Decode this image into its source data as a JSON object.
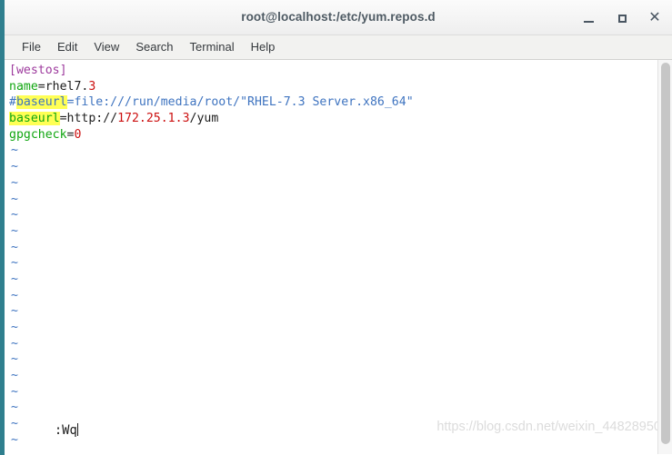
{
  "window": {
    "title": "root@localhost:/etc/yum.repos.d",
    "accent_border": "#2f7f8e",
    "controls": {
      "minimize": "_",
      "maximize": "□",
      "close": "✕"
    }
  },
  "menubar": {
    "items": [
      {
        "label": "File"
      },
      {
        "label": "Edit"
      },
      {
        "label": "View"
      },
      {
        "label": "Search"
      },
      {
        "label": "Terminal"
      },
      {
        "label": "Help"
      }
    ]
  },
  "editor": {
    "filler_char": "~",
    "filler_count": 19,
    "command_line": ":Wq",
    "lines": [
      {
        "segments": [
          {
            "text": "[westos]",
            "style": "c-section",
            "highlight": false
          }
        ]
      },
      {
        "segments": [
          {
            "text": "name",
            "style": "c-key",
            "highlight": false
          },
          {
            "text": "=rhel7.",
            "style": "c-plain",
            "highlight": false
          },
          {
            "text": "3",
            "style": "c-num",
            "highlight": false
          }
        ]
      },
      {
        "segments": [
          {
            "text": "#",
            "style": "c-comment",
            "highlight": false
          },
          {
            "text": "baseurl",
            "style": "c-comment",
            "highlight": true
          },
          {
            "text": "=file:///run/media/root/\"RHEL-7.3 Server.x86_64\"",
            "style": "c-comment",
            "highlight": false
          }
        ]
      },
      {
        "segments": [
          {
            "text": "baseurl",
            "style": "c-key",
            "highlight": true
          },
          {
            "text": "=http://",
            "style": "c-plain",
            "highlight": false
          },
          {
            "text": "172.25.1.3",
            "style": "c-num",
            "highlight": false
          },
          {
            "text": "/yum",
            "style": "c-plain",
            "highlight": false
          }
        ]
      },
      {
        "segments": [
          {
            "text": "gpgcheck",
            "style": "c-key",
            "highlight": false
          },
          {
            "text": "=",
            "style": "c-plain",
            "highlight": false
          },
          {
            "text": "0",
            "style": "c-num",
            "highlight": false
          }
        ]
      }
    ],
    "colors": {
      "section": "#9d3a9d",
      "key": "#11a611",
      "plain": "#1c1c1c",
      "number": "#cc1111",
      "comment": "#3f74c0",
      "search_highlight": "#ffff55",
      "background": "#ffffff"
    }
  },
  "watermark": {
    "text": "https://blog.csdn.net/weixin_44828950"
  }
}
